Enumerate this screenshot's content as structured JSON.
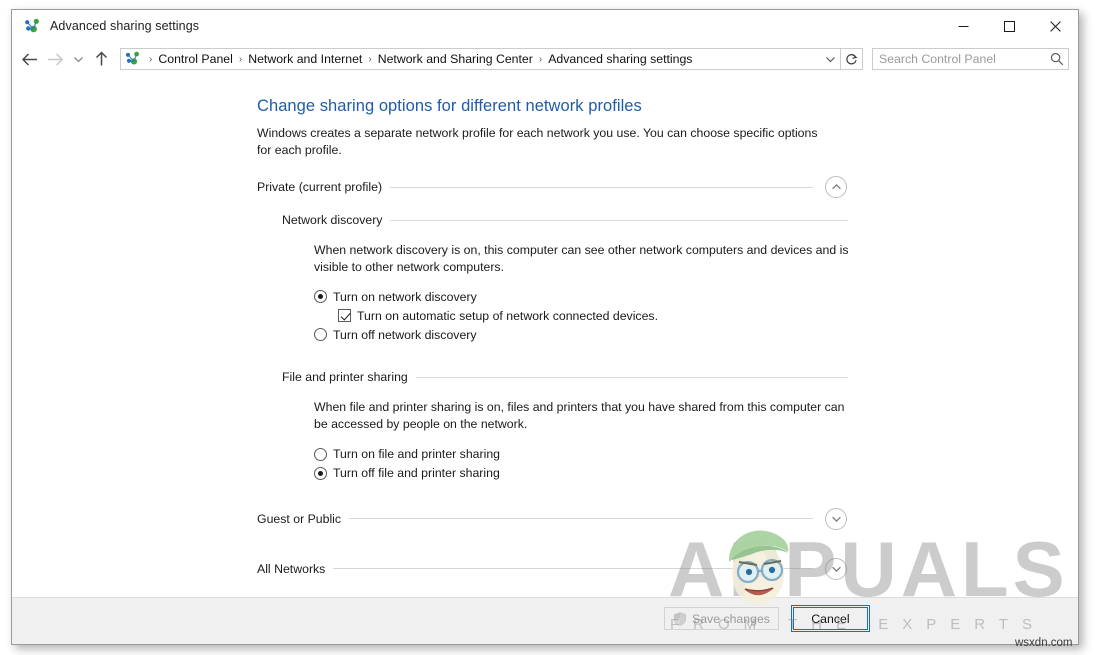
{
  "window": {
    "title": "Advanced sharing settings",
    "title_icon": "network-sharing-icon",
    "minimize_label": "─",
    "maximize_label": "□",
    "close_label": "✕"
  },
  "navbar": {
    "back_label": "←",
    "forward_label": "→",
    "recent_label": "⌄",
    "up_label": "↑",
    "address_icon": "network-sharing-icon",
    "breadcrumbs": [
      "Control Panel",
      "Network and Internet",
      "Network and Sharing Center",
      "Advanced sharing settings"
    ],
    "breadcrumb_separator": "❯",
    "dropdown_label": "⌄",
    "refresh_label": "↻",
    "search": {
      "placeholder": "Search Control Panel",
      "value": "",
      "icon": "search-icon"
    }
  },
  "content": {
    "page_title": "Change sharing options for different network profiles",
    "page_description": "Windows creates a separate network profile for each network you use. You can choose specific options for each profile.",
    "profiles": [
      {
        "name": "Private (current profile)",
        "expanded": true,
        "chevron": "chevron-up",
        "sections": [
          {
            "name": "Network discovery",
            "description": "When network discovery is on, this computer can see other network computers and devices and is visible to other network computers.",
            "options": [
              {
                "type": "radio",
                "label": "Turn on network discovery",
                "checked": true,
                "indent": false
              },
              {
                "type": "checkbox",
                "label": "Turn on automatic setup of network connected devices.",
                "checked": true,
                "indent": true
              },
              {
                "type": "radio",
                "label": "Turn off network discovery",
                "checked": false,
                "indent": false
              }
            ]
          },
          {
            "name": "File and printer sharing",
            "description": "When file and printer sharing is on, files and printers that you have shared from this computer can be accessed by people on the network.",
            "options": [
              {
                "type": "radio",
                "label": "Turn on file and printer sharing",
                "checked": false,
                "indent": false
              },
              {
                "type": "radio",
                "label": "Turn off file and printer sharing",
                "checked": true,
                "indent": false
              }
            ]
          }
        ]
      },
      {
        "name": "Guest or Public",
        "expanded": false,
        "chevron": "chevron-down",
        "sections": []
      },
      {
        "name": "All Networks",
        "expanded": false,
        "chevron": "chevron-down",
        "sections": []
      }
    ]
  },
  "footer": {
    "save_label": "Save changes",
    "save_enabled": false,
    "save_icon": "uac-shield-icon",
    "cancel_label": "Cancel",
    "cancel_focused": true
  },
  "watermark": {
    "word": "APPUALS",
    "tagline": "FROM THE EXPERTS",
    "site": "wsxdn.com",
    "mascot": "appuals-mascot-icon"
  },
  "colors": {
    "accent_blue": "#1f5caa",
    "focus_blue": "#1b6fb5",
    "icon_blue": "#1f6fc4",
    "icon_green": "#3fa535",
    "footer_bg": "#f0f0f0",
    "disabled_text": "#9b9b9b"
  }
}
